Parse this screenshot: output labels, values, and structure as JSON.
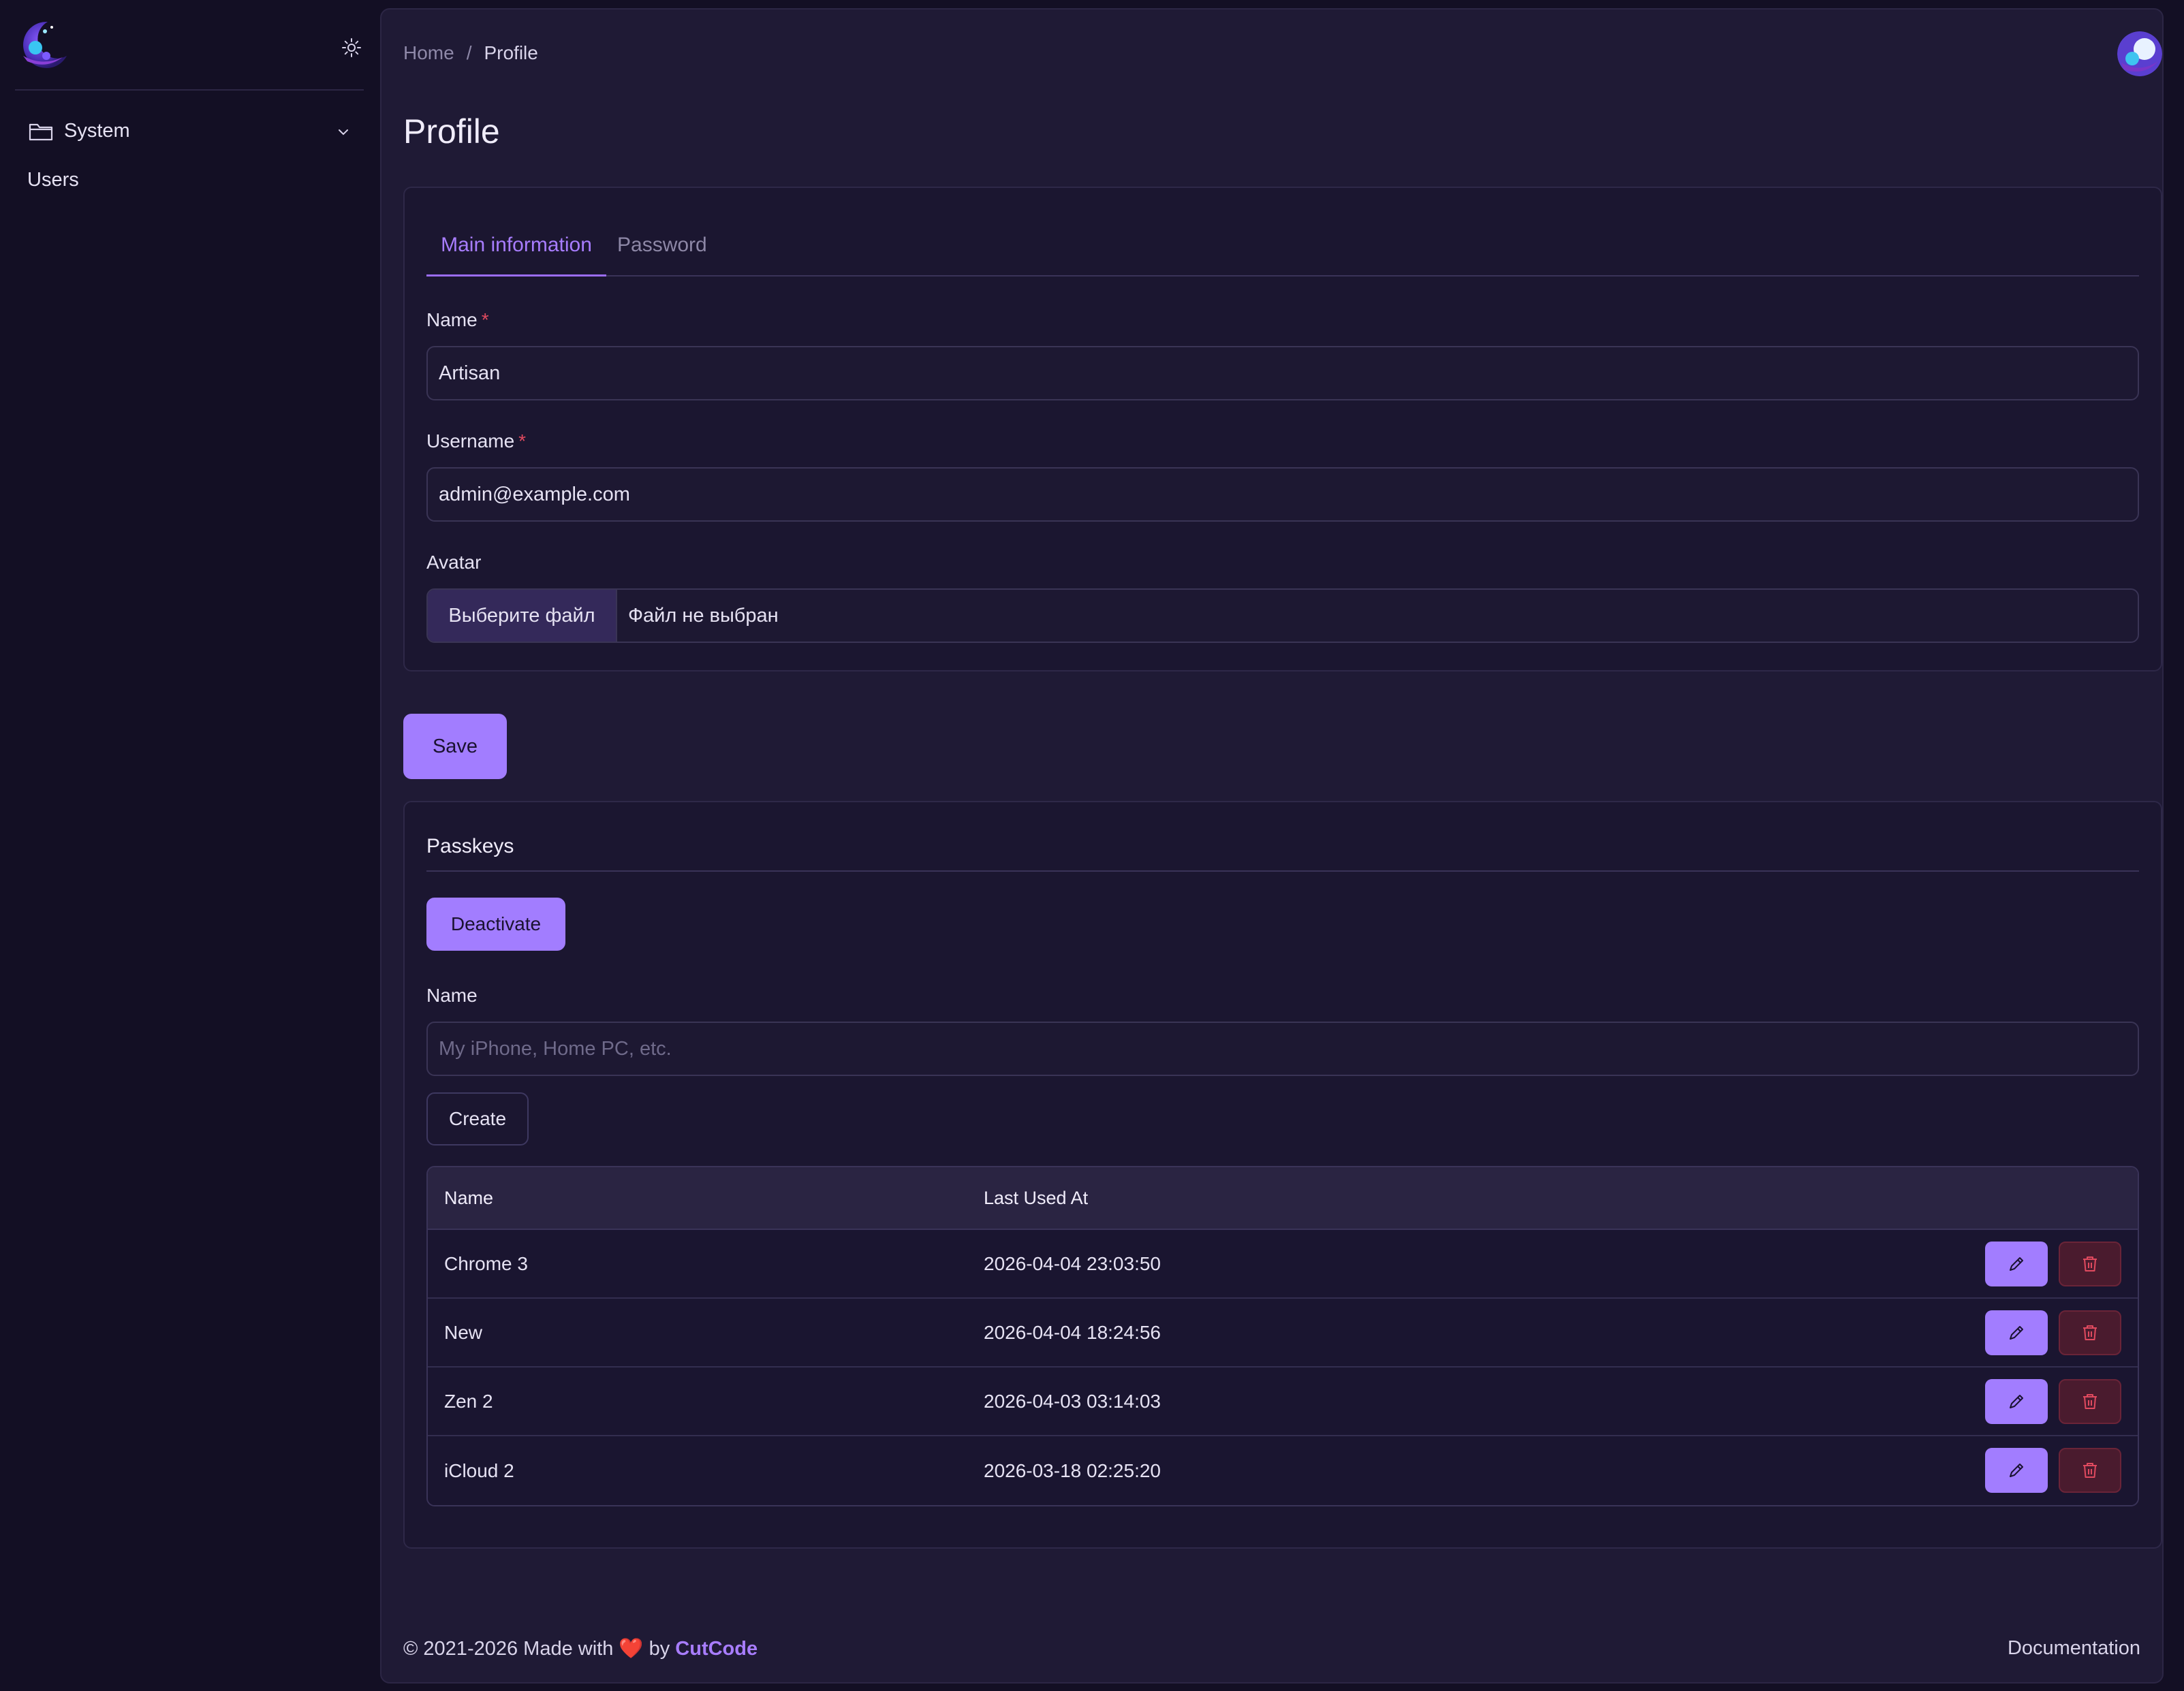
{
  "sidebar": {
    "logo_icon": "moon-logo-icon",
    "theme_icon": "sun-icon",
    "groups": [
      {
        "label": "System",
        "icon": "folder-icon",
        "chevron": "chevron-down-icon"
      }
    ],
    "items": [
      {
        "label": "Users"
      }
    ]
  },
  "breadcrumb": {
    "home": "Home",
    "separator": "/",
    "current": "Profile"
  },
  "page": {
    "title": "Profile"
  },
  "profile_form": {
    "tabs": [
      {
        "label": "Main information",
        "active": true
      },
      {
        "label": "Password",
        "active": false
      }
    ],
    "name": {
      "label": "Name",
      "required": "*",
      "value": "Artisan"
    },
    "username": {
      "label": "Username",
      "required": "*",
      "value": "admin@example.com"
    },
    "avatar": {
      "label": "Avatar",
      "button": "Выберите файл",
      "status": "Файл не выбран"
    },
    "save_label": "Save"
  },
  "passkeys": {
    "title": "Passkeys",
    "deactivate_label": "Deactivate",
    "name_label": "Name",
    "name_placeholder": "My iPhone, Home PC, etc.",
    "create_label": "Create",
    "columns": [
      "Name",
      "Last Used At"
    ],
    "rows": [
      {
        "name": "Chrome 3",
        "last_used": "2026-04-04 23:03:50"
      },
      {
        "name": "New",
        "last_used": "2026-04-04 18:24:56"
      },
      {
        "name": "Zen 2",
        "last_used": "2026-04-03 03:14:03"
      },
      {
        "name": "iCloud 2",
        "last_used": "2026-03-18 02:25:20"
      }
    ],
    "edit_icon": "pencil-icon",
    "delete_icon": "trash-icon"
  },
  "footer": {
    "copyright_prefix": "© 2021-2026 Made with",
    "heart": "❤️",
    "by": "by",
    "brand": "CutCode",
    "docs": "Documentation"
  },
  "colors": {
    "accent": "#a27dff",
    "background": "#130f24",
    "panel": "#1f1a35",
    "danger": "#e04a5f"
  }
}
